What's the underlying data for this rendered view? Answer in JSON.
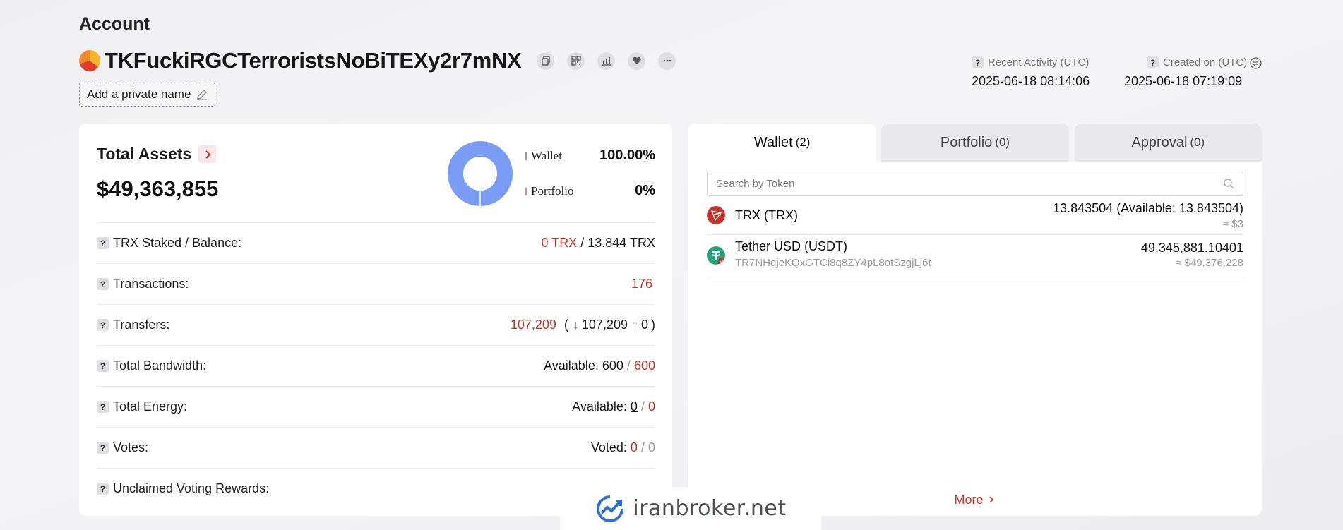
{
  "header": {
    "title": "Account",
    "address": "TKFuckiRGCTerroristsNoBiTEXy2r7mNX",
    "private_name_label": "Add a private name",
    "recent_activity_label": "Recent Activity (UTC)",
    "recent_activity_value": "2025-06-18 08:14:06",
    "created_label": "Created on (UTC)",
    "created_value": "2025-06-18 07:19:09",
    "actions": [
      "copy-icon",
      "qr-code-icon",
      "chart-icon",
      "heart-icon",
      "more-icon"
    ]
  },
  "assets": {
    "label": "Total Assets",
    "value": "$49,363,855",
    "legend": [
      {
        "name": "Wallet",
        "pct": "100.00%",
        "fraction": 1.0,
        "color": "#7b9cf5"
      },
      {
        "name": "Portfolio",
        "pct": "0%",
        "fraction": 0.0,
        "color": "#e98a8a"
      }
    ],
    "rows": {
      "staked": {
        "label": "TRX Staked / Balance:",
        "staked": "0 TRX",
        "sep": "/",
        "balance": "13.844 TRX"
      },
      "transactions": {
        "label": "Transactions:",
        "value": "176"
      },
      "transfers": {
        "label": "Transfers:",
        "total": "107,209",
        "open": "(",
        "in": "107,209",
        "out": "0",
        "close": ")"
      },
      "bandwidth": {
        "label": "Total Bandwidth:",
        "prefix": "Available:",
        "available": "600",
        "sep": "/",
        "total": "600"
      },
      "energy": {
        "label": "Total Energy:",
        "prefix": "Available:",
        "available": "0",
        "sep": "/",
        "total": "0"
      },
      "votes": {
        "label": "Votes:",
        "prefix": "Voted:",
        "voted": "0",
        "sep": "/",
        "total": "0"
      },
      "rewards": {
        "label": "Unclaimed Voting Rewards:"
      }
    }
  },
  "tokens": {
    "tabs": [
      {
        "label": "Wallet",
        "count": "(2)"
      },
      {
        "label": "Portfolio",
        "count": "(0)"
      },
      {
        "label": "Approval",
        "count": "(0)"
      }
    ],
    "search_placeholder": "Search by Token",
    "list": [
      {
        "name": "TRX (TRX)",
        "sub": "",
        "amount": "13.843504 (Available: 13.843504)",
        "usd": "≈ $3",
        "icon": "trx-icon"
      },
      {
        "name": "Tether USD (USDT)",
        "sub": "TR7NHqjeKQxGTCi8q8ZY4pL8otSzgjLj6t",
        "amount": "49,345,881.10401",
        "usd": "≈ $49,376,228",
        "icon": "usdt-icon"
      }
    ],
    "more_label": "More"
  },
  "watermark": {
    "text": "iranbroker.net"
  },
  "colors": {
    "accent_red": "#c0392b",
    "donut_blue": "#7b9cf5",
    "trx_red": "#c7342d",
    "usdt_green": "#26a17b"
  }
}
